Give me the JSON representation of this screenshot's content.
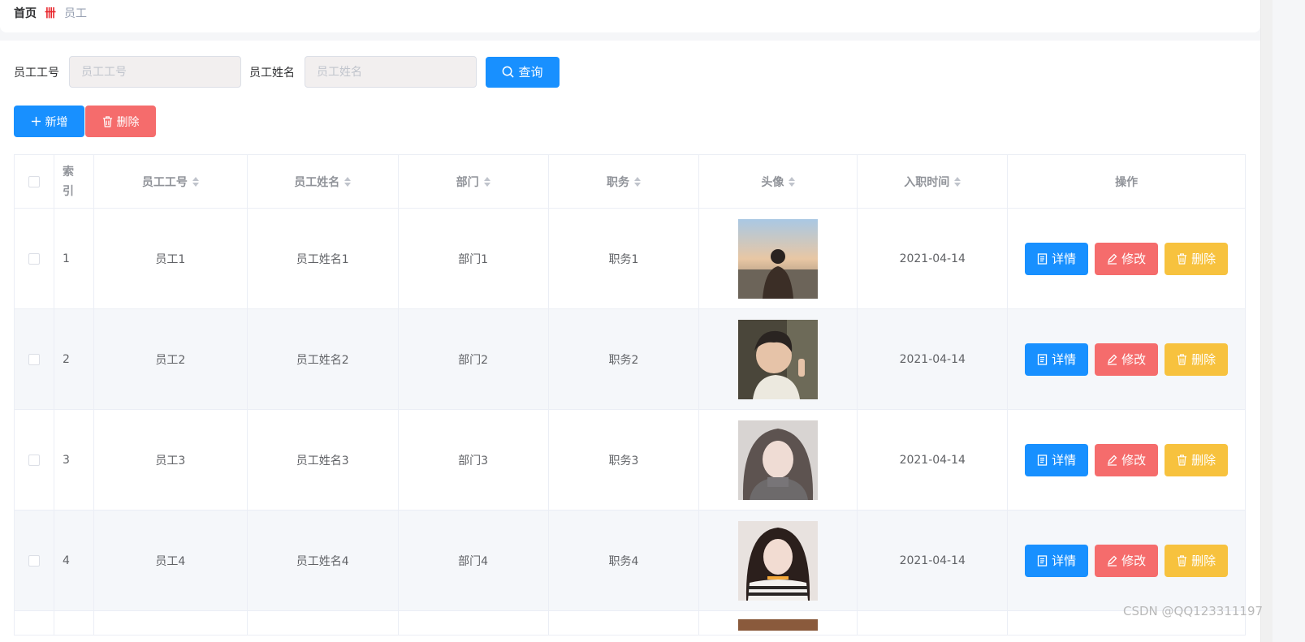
{
  "breadcrumb": {
    "home": "首页",
    "separator": "卌",
    "current": "员工"
  },
  "search": {
    "no_label": "员工工号",
    "no_placeholder": "员工工号",
    "name_label": "员工姓名",
    "name_placeholder": "员工姓名",
    "query_label": "查询"
  },
  "actions": {
    "add_label": "新增",
    "delete_label": "删除"
  },
  "table": {
    "headers": {
      "index": "索引",
      "no": "员工工号",
      "name": "员工姓名",
      "dept": "部门",
      "position": "职务",
      "avatar": "头像",
      "date": "入职时间",
      "ops": "操作"
    },
    "rows": [
      {
        "index": "1",
        "no": "员工1",
        "name": "员工姓名1",
        "dept": "部门1",
        "position": "职务1",
        "date": "2021-04-14"
      },
      {
        "index": "2",
        "no": "员工2",
        "name": "员工姓名2",
        "dept": "部门2",
        "position": "职务2",
        "date": "2021-04-14"
      },
      {
        "index": "3",
        "no": "员工3",
        "name": "员工姓名3",
        "dept": "部门3",
        "position": "职务3",
        "date": "2021-04-14"
      },
      {
        "index": "4",
        "no": "员工4",
        "name": "员工姓名4",
        "dept": "部门4",
        "position": "职务4",
        "date": "2021-04-14"
      }
    ],
    "row_actions": {
      "detail": "详情",
      "edit": "修改",
      "delete": "删除"
    }
  },
  "watermark": "CSDN @QQ123311197",
  "colors": {
    "primary": "#1890ff",
    "danger": "#f56c6c",
    "warning": "#f7c23e",
    "accent_red": "#e8262d"
  }
}
